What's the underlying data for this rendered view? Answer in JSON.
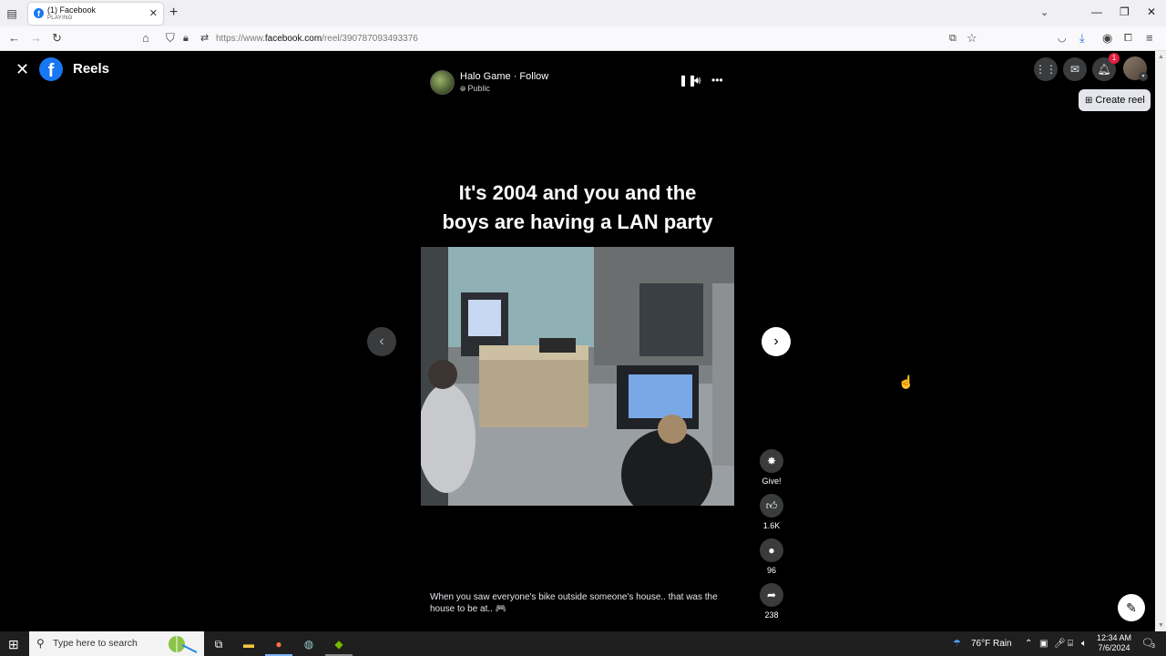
{
  "browser": {
    "tab": {
      "title": "(1) Facebook",
      "status": "PLAYING",
      "favicon": "f"
    },
    "url_prefix": "https://www.",
    "url_domain": "facebook.com",
    "url_path": "/reel/390787093493376"
  },
  "header": {
    "section_title": "Reels",
    "notification_count": "1",
    "create_reel_label": "Create reel"
  },
  "reel": {
    "page_name": "Halo Game · Follow",
    "audience": "Public",
    "overlay_line1": "It's 2004 and you and the",
    "overlay_line2": "boys are having a LAN party",
    "caption_line1": "When you saw everyone's bike outside someone's house.. that was the",
    "caption_line2": "house to be at.. 🎮",
    "actions": [
      {
        "icon": "star-gift-icon",
        "label": "Give!"
      },
      {
        "icon": "like-icon",
        "label": "1.6K"
      },
      {
        "icon": "comment-icon",
        "label": "96"
      },
      {
        "icon": "share-icon",
        "label": "238"
      }
    ]
  },
  "taskbar": {
    "search_placeholder": "Type here to search",
    "weather": "76°F  Rain",
    "time": "12:34 AM",
    "date": "7/6/2024",
    "notification_count": "3"
  },
  "colors": {
    "facebook_blue": "#1877f2",
    "badge_red": "#e41e3f",
    "control_gray": "#3a3b3c"
  }
}
